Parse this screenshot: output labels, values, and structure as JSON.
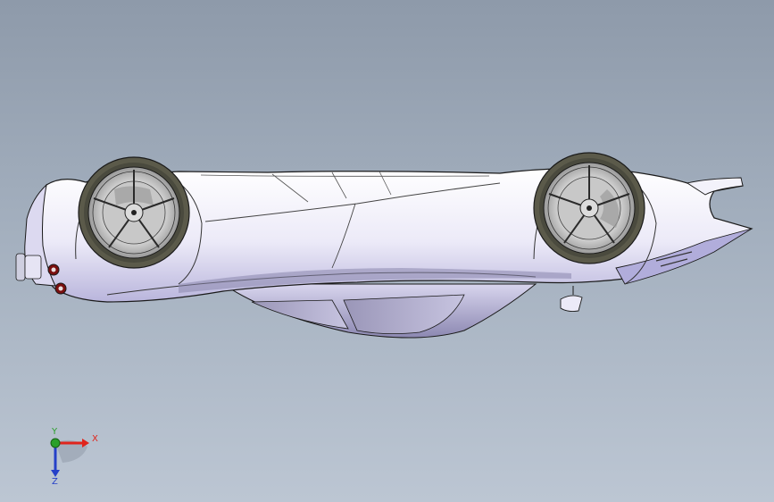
{
  "viewport": {
    "background_top": "#8e9aaa",
    "background_bottom": "#bcc6d3",
    "model_name": "car-model-upside-down"
  },
  "triad": {
    "x_label": "X",
    "y_label": "Y",
    "z_label": "Z",
    "x_color": "#e0241c",
    "y_color": "#2aa02a",
    "z_color": "#2540c8"
  },
  "colors": {
    "body": "#efeefb",
    "body_shade": "#c9c6e6",
    "dark_shade": "#8a86ad",
    "outline": "#1a1a1a",
    "tire": "#4a4a3e",
    "rim": "#d9d9d9"
  }
}
